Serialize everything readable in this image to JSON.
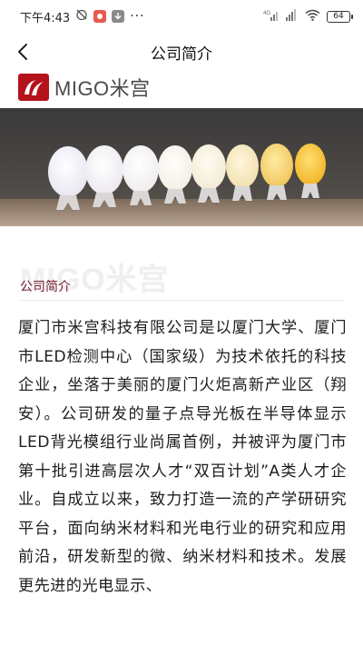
{
  "status_bar": {
    "time": "下午4:43",
    "more": "···",
    "network": "4G",
    "battery": "64",
    "icons": [
      "alarm-off-icon",
      "app-notification-icon",
      "download-icon",
      "signal-icon",
      "signal-icon",
      "wifi-icon",
      "battery-icon"
    ]
  },
  "nav": {
    "back_icon": "chevron-left-icon",
    "title": "公司简介"
  },
  "logo": {
    "text": "MIGO米宫",
    "brand_color": "#b5121b"
  },
  "watermark": "MIGO米宫",
  "section": {
    "label": "公司简介",
    "label_color": "#6e1a2a"
  },
  "article": {
    "body": "厦门市米宫科技有限公司是以厦门大学、厦门市LED检测中心（国家级）为技术依托的科技企业，坐落于美丽的厦门火炬高新产业区（翔安）。公司研发的量子点导光板在半导体显示LED背光模组行业尚属首例，并被评为厦门市第十批引进高层次人才“双百计划”A类人才企业。自成立以来，致力打造一流的产学研研究平台，面向纳米材料和光电行业的研究和应用前沿，研发新型的微、纳米材料和技术。发展更先进的光电显示、"
  }
}
